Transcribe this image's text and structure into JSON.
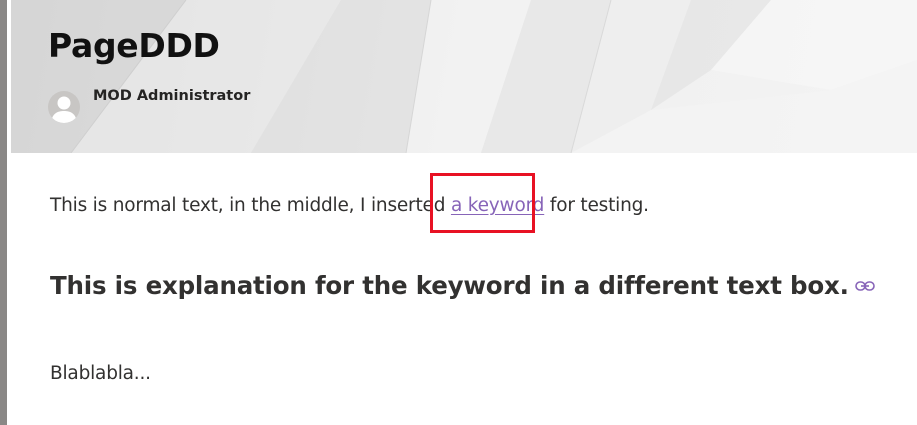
{
  "header": {
    "title": "PageDDD",
    "author": {
      "name": "MOD Administrator",
      "avatar_icon": "person-avatar-icon"
    }
  },
  "content": {
    "paragraph": {
      "before_link": "This is normal text, in the middle, I inserted ",
      "link_text": "a keyword",
      "after_link": " for testing."
    },
    "heading": "This is explanation for the keyword in a different text box.",
    "heading_anchor_icon": "link-icon",
    "body": "Blablabla..."
  },
  "colors": {
    "link": "#8764b8",
    "highlight": "#e81123",
    "text": "#323130",
    "title": "#111111"
  }
}
